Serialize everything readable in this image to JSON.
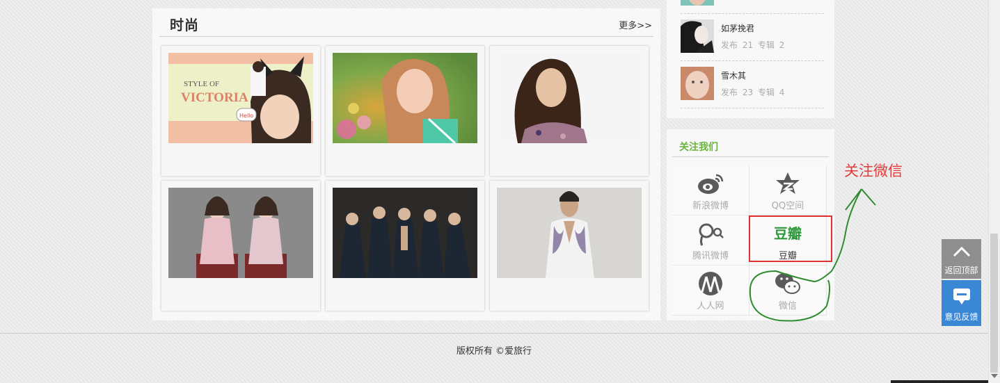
{
  "section": {
    "title": "时尚",
    "more": "更多>>"
  },
  "photos": [
    {
      "alt": "Style of Victoria"
    },
    {
      "alt": "girl in garden"
    },
    {
      "alt": "long hair portrait"
    },
    {
      "alt": "two girls in chairs"
    },
    {
      "alt": "band group photo"
    },
    {
      "alt": "man in white shirt"
    }
  ],
  "photo_text": {
    "style_of": "STYLE OF",
    "victoria": "VICTORIA",
    "hello": "Hello"
  },
  "authors": [
    {
      "name": "如茅挽君",
      "stats_label1": "发布",
      "posts": "21",
      "stats_label2": "专辑",
      "albums": "2"
    },
    {
      "name": "雪木其",
      "stats_label1": "发布",
      "posts": "23",
      "stats_label2": "专辑",
      "albums": "4"
    }
  ],
  "follow": {
    "title": "关注我们",
    "items": [
      {
        "label": "新浪微博",
        "icon": "weibo-icon"
      },
      {
        "label": "QQ空间",
        "icon": "qzone-icon"
      },
      {
        "label": "腾讯微博",
        "icon": "tencent-weibo-icon"
      },
      {
        "label": "豆瓣",
        "icon": "douban-icon",
        "logo_text": "豆瓣"
      },
      {
        "label": "人人网",
        "icon": "renren-icon"
      },
      {
        "label": "微信",
        "icon": "wechat-icon"
      }
    ]
  },
  "annotation": {
    "text": "关注微信",
    "color": "#e23b3b",
    "stroke_color": "#2e8b2e"
  },
  "footer": {
    "copyright": "版权所有 ©爱旅行"
  },
  "float_buttons": {
    "back_top": "返回顶部",
    "feedback": "意见反馈"
  },
  "colors": {
    "accent_green": "#6ab23f",
    "douban_green": "#2c9a3a",
    "feedback_blue": "#3a87d6",
    "back_top_gray": "#8f8f8f"
  }
}
